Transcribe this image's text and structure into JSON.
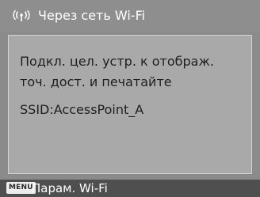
{
  "header": {
    "title": "Через сеть Wi-Fi",
    "icon": "wifi-signal-icon"
  },
  "panel": {
    "message": "Подкл. цел. устр. к отображ.\nточ. дост. и печатайте",
    "ssid_label": "SSID:",
    "ssid_value": "AccessPoint_A"
  },
  "footer": {
    "menu_label": "MENU",
    "action_label": "Парам. Wi-Fi"
  },
  "colors": {
    "background": "#8b8b8b",
    "panel": "#a9a9a9",
    "panel_border": "#d3d3d3",
    "footer": "#4f4f4f",
    "text_light": "#ffffff",
    "text_dark": "#1f1f1f"
  }
}
